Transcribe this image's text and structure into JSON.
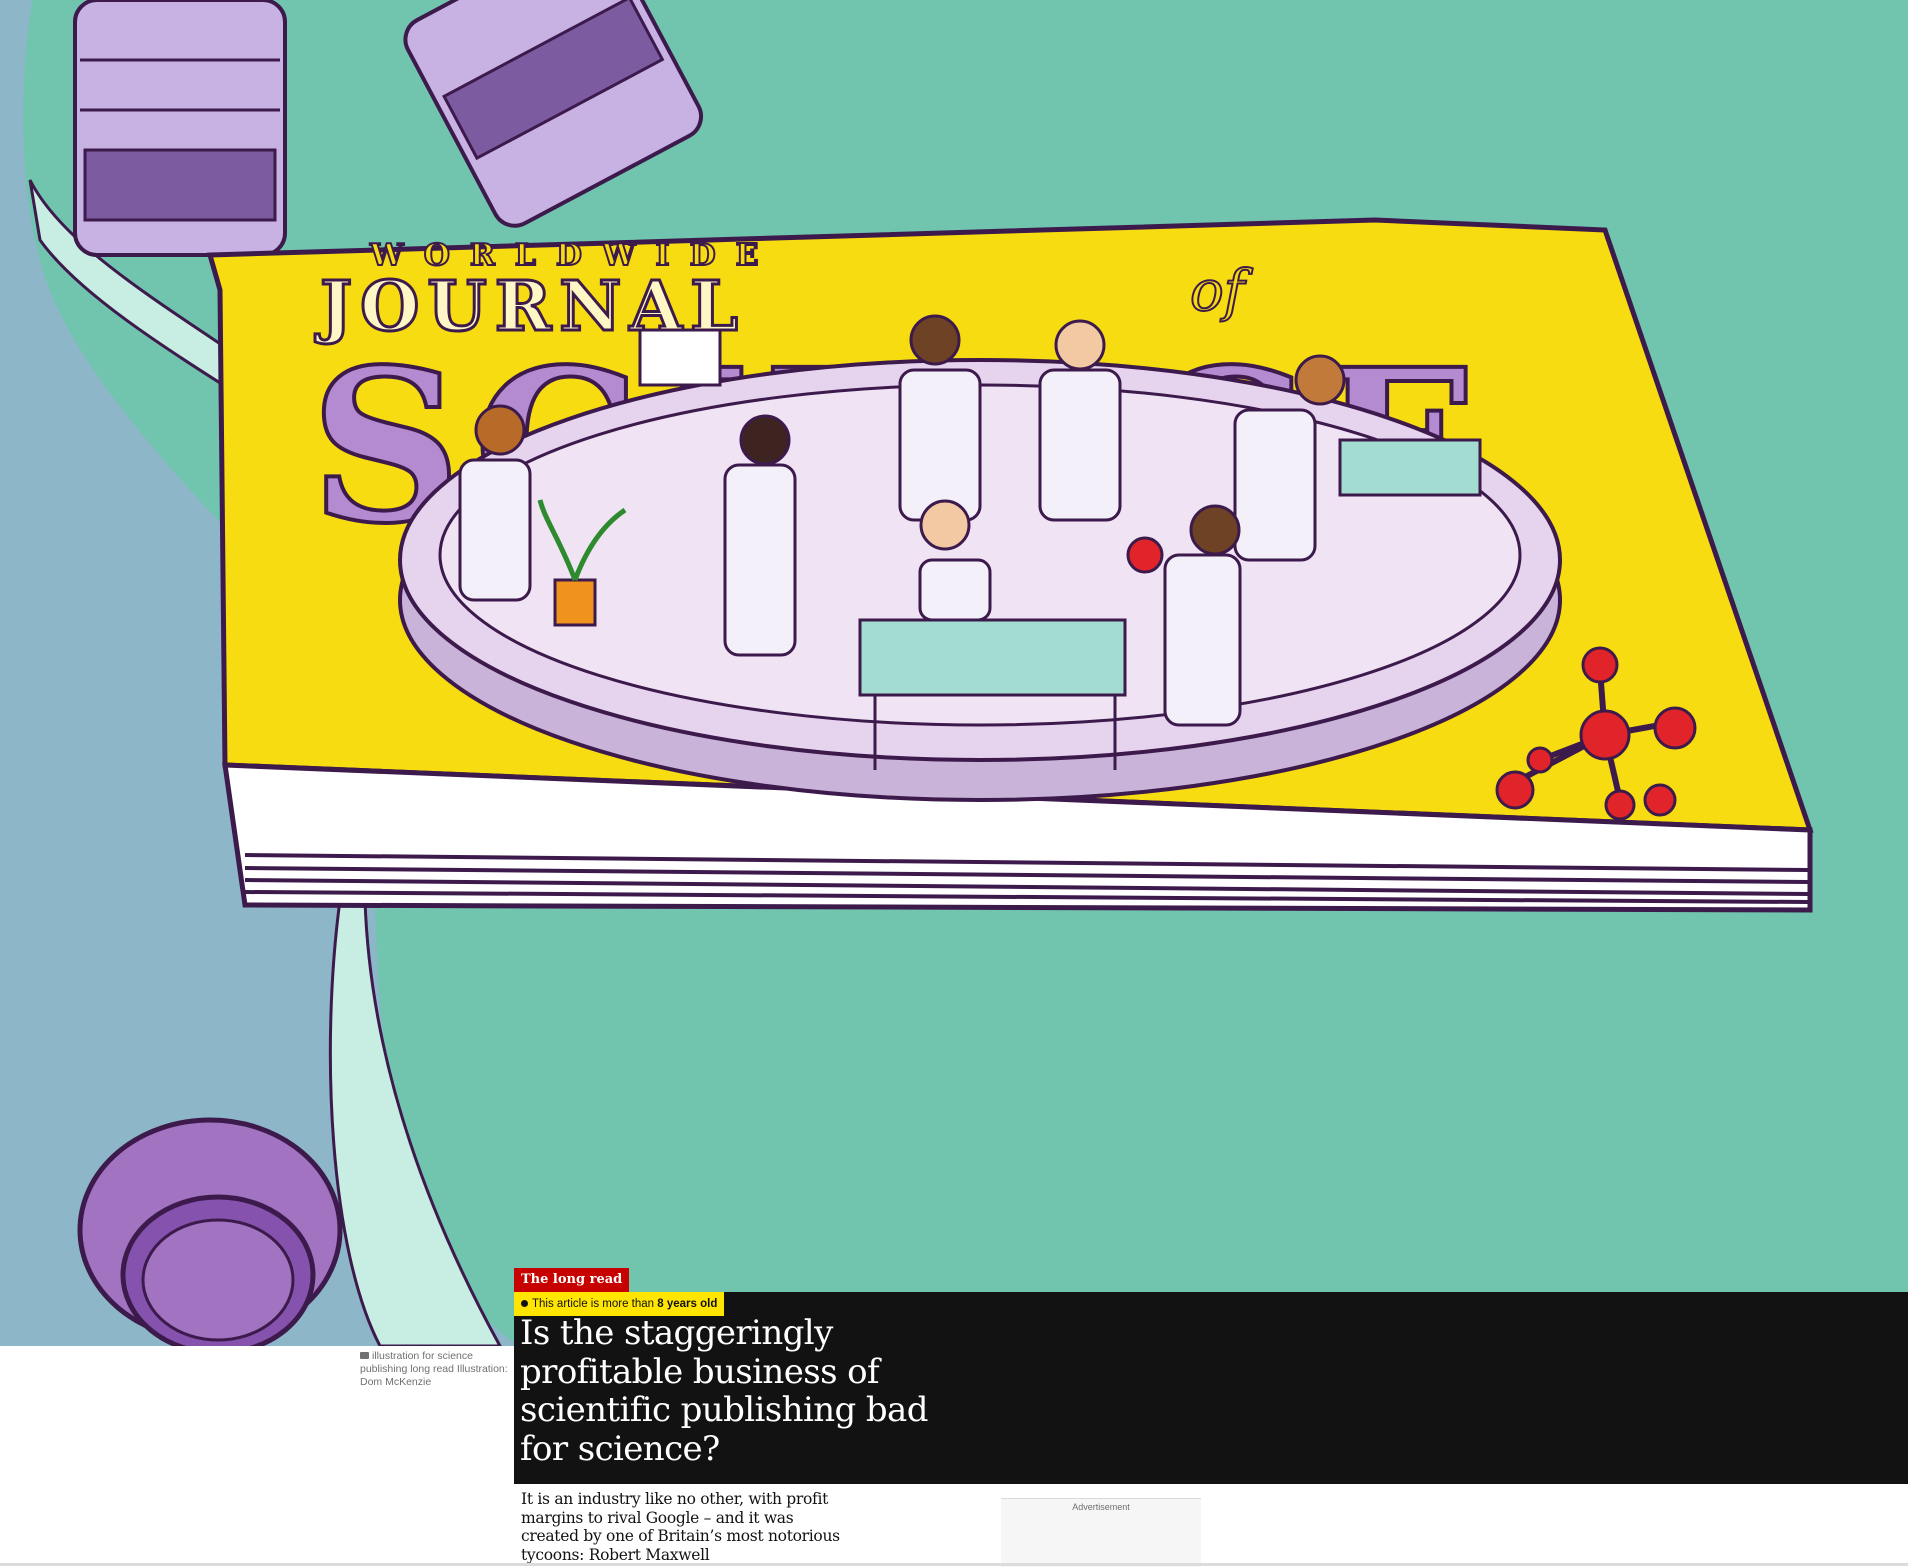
{
  "article": {
    "kicker": "The long read",
    "age_notice": {
      "prefix": "This article is more than",
      "value": "8 years old"
    },
    "headline": "Is the staggeringly profitable business of scientific publishing bad for science?",
    "standfirst": "It is an industry like no other, with profit margins to rival Google – and it was created by one of Britain’s most notorious tycoons: Robert Maxwell"
  },
  "hero_image": {
    "caption": "illustration for science publishing long read Illustration: Dom McKenzie",
    "magazine_lettering": {
      "line1": "WORLDWIDE",
      "line2": "JOURNAL",
      "line3": "of",
      "line4": "SCIENCE"
    },
    "colors": {
      "background": "#71c4ae",
      "left_panel": "#8db7c9",
      "magazine": "#f7dc12",
      "dish": "#e6d3ee",
      "outline": "#3d1a4c",
      "microscope": "#c7b2e3"
    }
  },
  "advertisement": {
    "label": "Advertisement"
  },
  "colors": {
    "kicker_bg": "#c70000",
    "badge_bg": "#ffe500",
    "headline_bg": "#121212"
  }
}
